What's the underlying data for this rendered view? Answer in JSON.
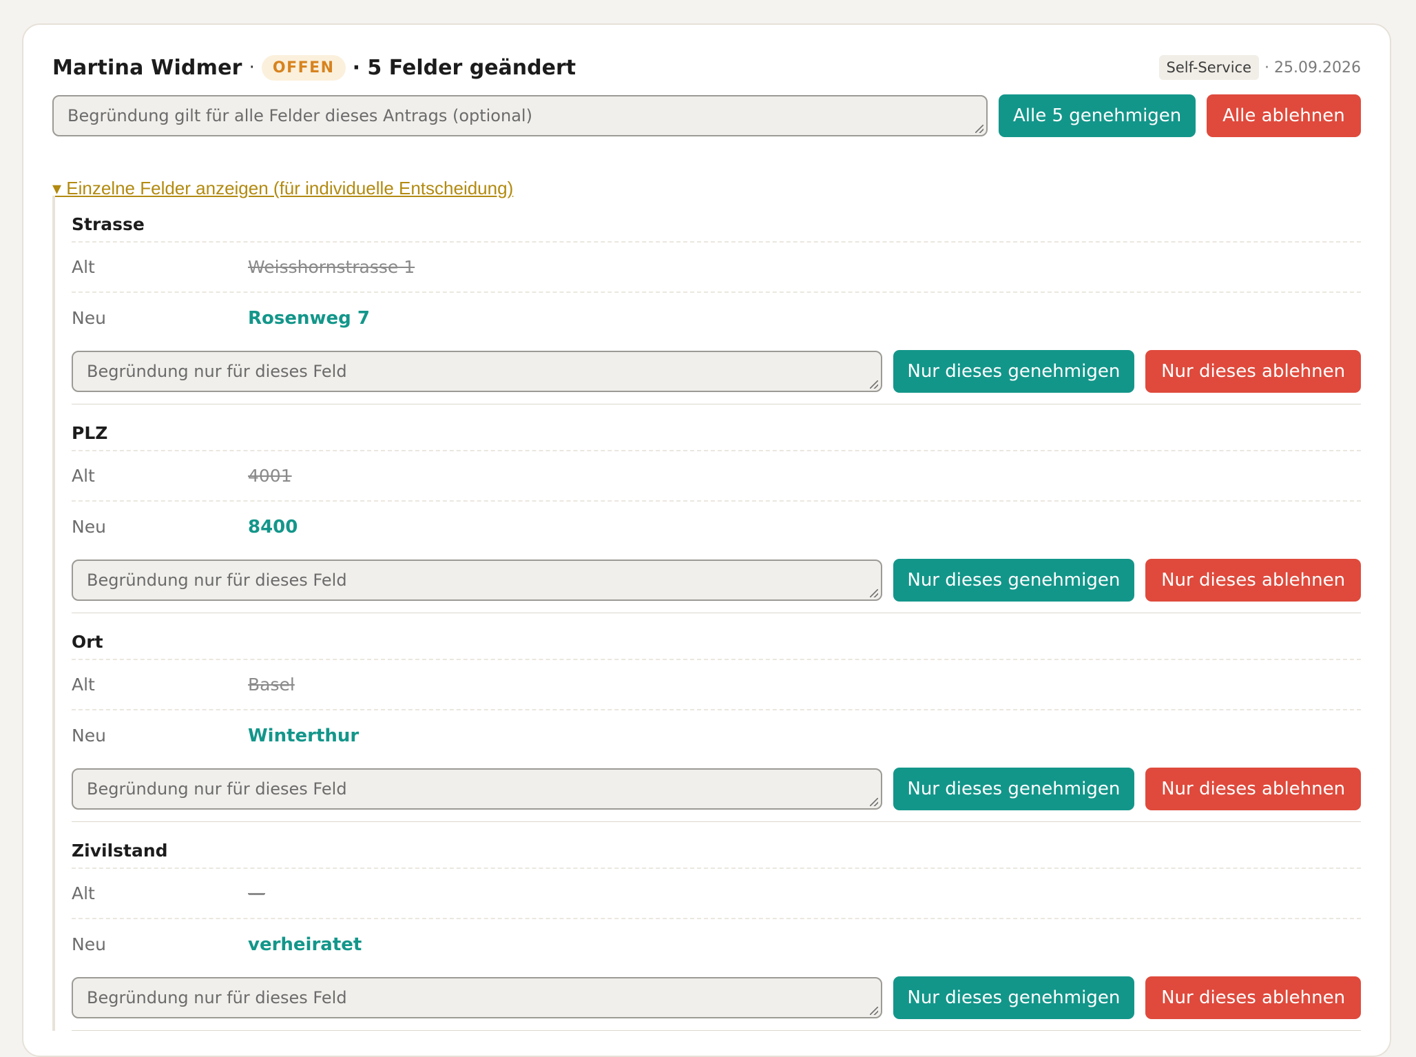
{
  "header": {
    "name": "Martina Widmer",
    "sep1": "·",
    "status": "OFFEN",
    "summary": "· 5 Felder geändert",
    "source": "Self-Service",
    "date": "· 25.09.2026"
  },
  "global": {
    "reason_placeholder": "Begründung gilt für alle Felder dieses Antrags (optional)",
    "approve_all": "Alle 5 genehmigen",
    "reject_all": "Alle ablehnen"
  },
  "toggle": "▾ Einzelne Felder anzeigen (für individuelle Entscheidung)",
  "labels": {
    "old": "Alt",
    "new": "Neu",
    "reason_placeholder": "Begründung nur für dieses Feld",
    "approve": "Nur dieses genehmigen",
    "reject": "Nur dieses ablehnen"
  },
  "fields": [
    {
      "name": "Strasse",
      "old": "Weisshornstrasse 1",
      "new": "Rosenweg 7"
    },
    {
      "name": "PLZ",
      "old": "4001",
      "new": "8400"
    },
    {
      "name": "Ort",
      "old": "Basel",
      "new": "Winterthur"
    },
    {
      "name": "Zivilstand",
      "old": "—",
      "new": "verheiratet"
    }
  ],
  "colors": {
    "approve": "#13968a",
    "reject": "#df4a3c",
    "status_open": "#d7831f",
    "link": "#b28a10"
  }
}
